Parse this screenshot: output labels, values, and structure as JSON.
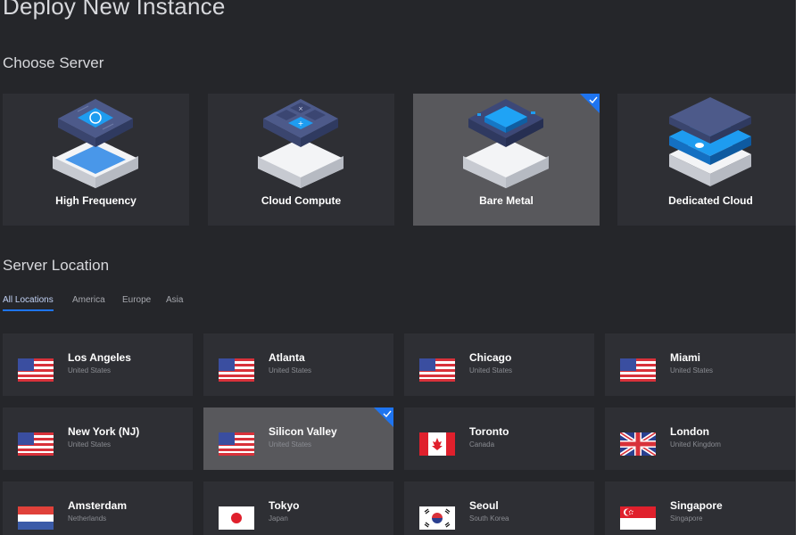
{
  "page": {
    "title": "Deploy New Instance"
  },
  "server": {
    "section_title": "Choose Server",
    "options": [
      {
        "label": "High Frequency",
        "selected": false
      },
      {
        "label": "Cloud Compute",
        "selected": false
      },
      {
        "label": "Bare Metal",
        "selected": true
      },
      {
        "label": "Dedicated Cloud",
        "selected": false
      }
    ]
  },
  "location": {
    "section_title": "Server Location",
    "tabs": [
      {
        "label": "All Locations",
        "active": true
      },
      {
        "label": "America",
        "active": false
      },
      {
        "label": "Europe",
        "active": false
      },
      {
        "label": "Asia",
        "active": false
      }
    ],
    "items": [
      {
        "city": "Los Angeles",
        "country": "United States",
        "flag": "us-flag",
        "selected": false
      },
      {
        "city": "Atlanta",
        "country": "United States",
        "flag": "us-flag",
        "selected": false
      },
      {
        "city": "Chicago",
        "country": "United States",
        "flag": "us-flag",
        "selected": false
      },
      {
        "city": "Miami",
        "country": "United States",
        "flag": "us-flag",
        "selected": false
      },
      {
        "city": "New York (NJ)",
        "country": "United States",
        "flag": "us-flag",
        "selected": false
      },
      {
        "city": "Silicon Valley",
        "country": "United States",
        "flag": "us-flag",
        "selected": true
      },
      {
        "city": "Toronto",
        "country": "Canada",
        "flag": "canada-flag",
        "selected": false
      },
      {
        "city": "London",
        "country": "United Kingdom",
        "flag": "uk-flag",
        "selected": false
      },
      {
        "city": "Amsterdam",
        "country": "Netherlands",
        "flag": "netherlands-flag",
        "selected": false
      },
      {
        "city": "Tokyo",
        "country": "Japan",
        "flag": "japan-flag",
        "selected": false
      },
      {
        "city": "Seoul",
        "country": "South Korea",
        "flag": "south-korea-flag",
        "selected": false
      },
      {
        "city": "Singapore",
        "country": "Singapore",
        "flag": "singapore-flag",
        "selected": false
      }
    ]
  },
  "colors": {
    "background": "#25262a",
    "card": "#2e2f34",
    "card_selected": "#58585c",
    "accent": "#1e74f0"
  }
}
